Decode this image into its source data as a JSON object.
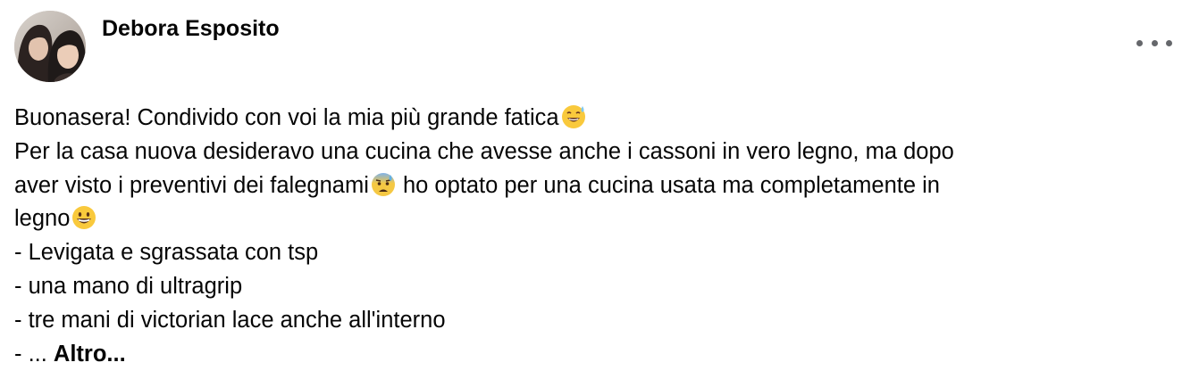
{
  "post": {
    "author": "Debora Esposito",
    "more_icon": "three-dots-horizontal-icon",
    "lines": [
      "Buonasera! Condivido con voi la mia più grande fatica",
      "Per la casa nuova desideravo una cucina che avesse anche i cassoni in vero legno, ma dopo",
      "aver visto i preventivi dei falegnami",
      " ho optato per una cucina usata ma completamente in",
      "legno",
      "- Levigata e sgrassata con tsp",
      "- una mano di ultragrip",
      "- tre mani di victorian lace anche all'interno",
      "- ... ",
      "Altro..."
    ],
    "emojis": {
      "sweat_smile": "grinning-face-with-sweat-emoji",
      "anxious": "anxious-face-with-sweat-emoji",
      "grin": "grinning-face-emoji"
    }
  }
}
